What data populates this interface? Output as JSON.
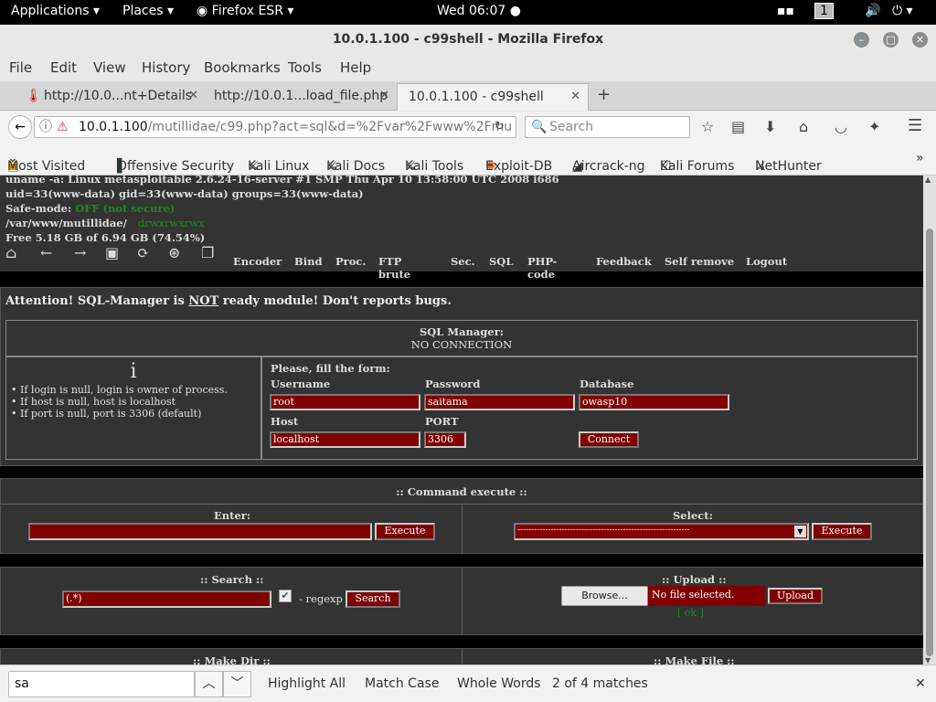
{
  "topbar": {
    "applications": "Applications",
    "places": "Places",
    "app": "Firefox ESR",
    "clock": "Wed 06:07",
    "workspace": "1"
  },
  "window": {
    "title": "10.0.1.100 - c99shell - Mozilla Firefox"
  },
  "menu": [
    "File",
    "Edit",
    "View",
    "History",
    "Bookmarks",
    "Tools",
    "Help"
  ],
  "tabs": [
    {
      "label": "http://10.0...nt+Details"
    },
    {
      "label": "http://10.0.1...load_file.php"
    },
    {
      "label": "10.0.1.100 - c99shell"
    }
  ],
  "url": {
    "host": "10.0.1.100",
    "path": "/mutillidae/c99.php?act=sql&d=%2Fvar%2Fwww%2Fmu"
  },
  "search": {
    "placeholder": "Search"
  },
  "bookmarks": [
    "Most Visited",
    "Offensive Security",
    "Kali Linux",
    "Kali Docs",
    "Kali Tools",
    "Exploit-DB",
    "Aircrack-ng",
    "Kali Forums",
    "NetHunter"
  ],
  "shell": {
    "uname": "uname -a: Linux metasploitable 2.6.24-16-server #1 SMP Thu Apr 10 13:58:00 UTC 2008 i686",
    "uid": "uid=33(www-data) gid=33(www-data) groups=33(www-data)",
    "safemode_label": "Safe-mode:",
    "safemode_value": "OFF (not secure)",
    "path": "/var/www/mutillidae/",
    "perms": "drwxrwxrwx",
    "free": "Free 5.18 GB of 6.94 GB (74.54%)",
    "nav": [
      "Encoder",
      "Bind",
      "Proc.",
      "FTP brute",
      "Sec.",
      "SQL",
      "PHP-code",
      "Feedback",
      "Self remove",
      "Logout"
    ]
  },
  "sql": {
    "attention_pre": "Attention! SQL-Manager is ",
    "attention_not": "NOT",
    "attention_post": " ready module! Don't reports bugs.",
    "header": "SQL Manager:",
    "status": "NO CONNECTION",
    "info_icon": "i",
    "notes": [
      "• If login is null, login is owner of process.",
      "• If host is null, host is localhost",
      "• If port is null, port is 3306 (default)"
    ],
    "form_title": "Please, fill the form:",
    "username_label": "Username",
    "username": "root",
    "password_label": "Password",
    "password": "saitama",
    "database_label": "Database",
    "database": "owasp10",
    "host_label": "Host",
    "host": "localhost",
    "port_label": "PORT",
    "port": "3306",
    "connect": "Connect"
  },
  "cmd": {
    "title": ":: Command execute ::",
    "enter": "Enter:",
    "select": "Select:",
    "execute": "Execute",
    "select_value": "--------------------------------------------------------------"
  },
  "searchpanel": {
    "title": ":: Search ::",
    "value": "(.*)",
    "regexp": "- regexp",
    "button": "Search"
  },
  "upload": {
    "title": ":: Upload ::",
    "browse": "Browse...",
    "nofile": "No file selected.",
    "button": "Upload",
    "ok": "[ ok ]"
  },
  "bottom": {
    "makedir": ":: Make Dir ::",
    "makefile": ":: Make File ::"
  },
  "find": {
    "value": "sa",
    "highlight": "Highlight All",
    "matchcase": "Match Case",
    "whole": "Whole Words",
    "count": "2 of 4 matches"
  }
}
